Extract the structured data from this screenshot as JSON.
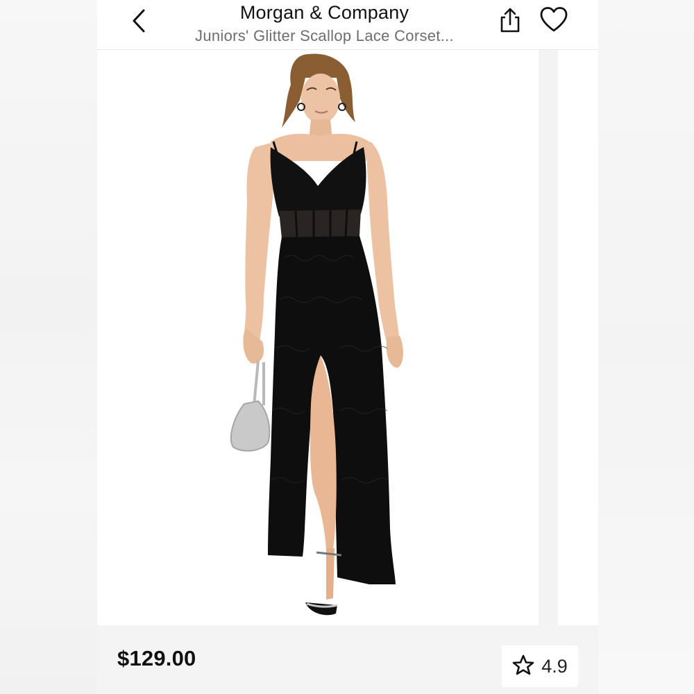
{
  "header": {
    "brand": "Morgan & Company",
    "product_name": "Juniors' Glitter Scallop Lace Corset...",
    "back_icon": "chevron-left-icon",
    "share_icon": "share-icon",
    "favorite_icon": "heart-icon"
  },
  "product": {
    "price": "$129.00",
    "rating": "4.9",
    "rating_icon": "star-icon",
    "dress_color": "#0e0e0e",
    "background_color": "#ffffff"
  }
}
